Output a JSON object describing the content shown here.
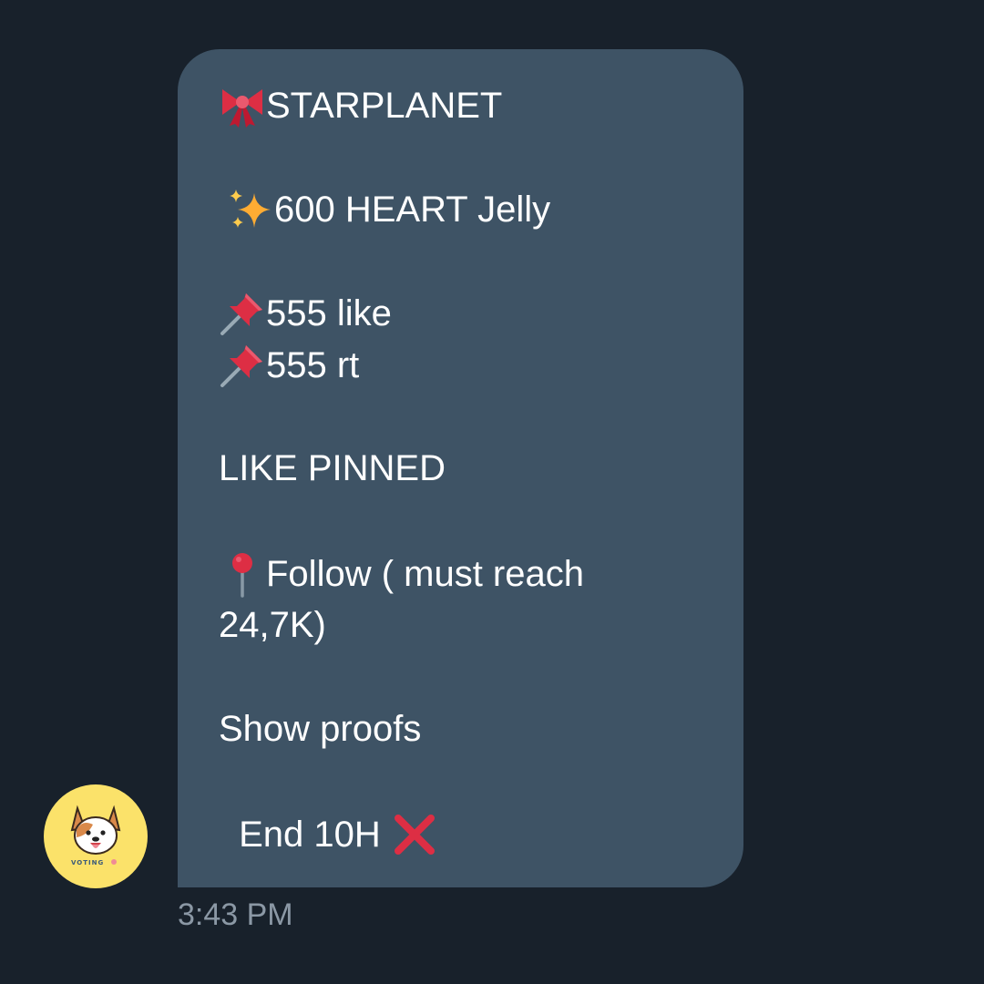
{
  "message": {
    "lines": [
      {
        "icon": "ribbon-icon",
        "text": "STARPLANET"
      },
      {
        "icon": "sparkles-icon",
        "text": "600 HEART Jelly"
      },
      {
        "icon": "pushpin-icon",
        "text": "555 like"
      },
      {
        "icon": "pushpin-icon",
        "text": "555 rt"
      },
      {
        "icon": "",
        "text": "LIKE PINNED"
      },
      {
        "icon": "round-pushpin-icon",
        "text": " Follow ( must reach"
      },
      {
        "icon": "",
        "text": "24,7K)"
      },
      {
        "icon": "",
        "text": "Show proofs"
      },
      {
        "icon": "cross-mark-icon",
        "text": " End 10H "
      }
    ],
    "timestamp": "3:43 PM"
  },
  "sender": {
    "avatar_icon": "dog-avatar-icon",
    "avatar_text": "VOTING"
  },
  "colors": {
    "background": "#18212b",
    "bubble": "#3e5365",
    "text": "#ffffff",
    "timestamp": "#8b98a5",
    "avatar_bg": "#fbe26a"
  }
}
